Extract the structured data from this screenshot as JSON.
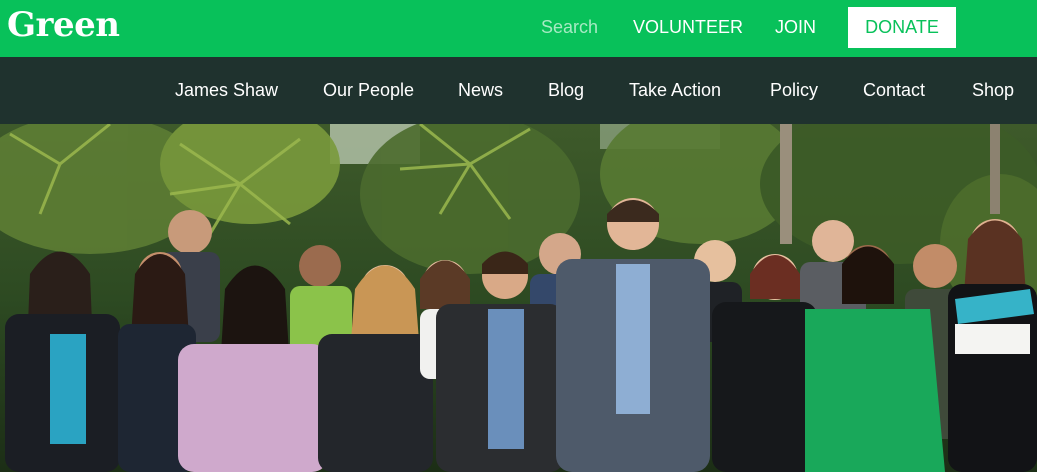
{
  "header": {
    "logo_text": "Green",
    "search_placeholder": "Search",
    "volunteer_label": "VOLUNTEER",
    "join_label": "JOIN",
    "donate_label": "DONATE"
  },
  "nav": {
    "items": [
      "James Shaw",
      "Our People",
      "News",
      "Blog",
      "Take Action",
      "Policy",
      "Contact",
      "Shop"
    ]
  },
  "colors": {
    "brand_green": "#08c15a",
    "nav_dark": "#1f322e",
    "donate_bg": "#ffffff"
  },
  "hero": {
    "image_description": "Group photo of party members standing outdoors in front of tropical foliage"
  }
}
